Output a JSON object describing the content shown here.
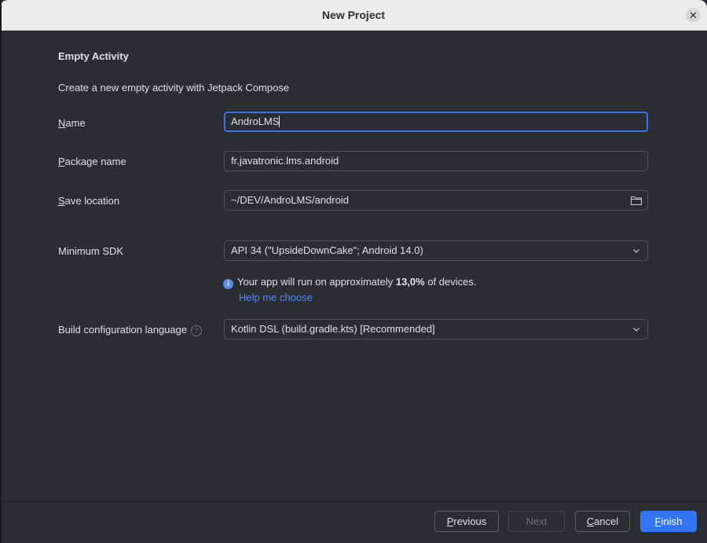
{
  "window": {
    "title": "New Project"
  },
  "header": {
    "section_title": "Empty Activity",
    "description": "Create a new empty activity with Jetpack Compose"
  },
  "form": {
    "name": {
      "label_mnemonic": "N",
      "label_rest": "ame",
      "value": "AndroLMS"
    },
    "package_name": {
      "label_mnemonic": "P",
      "label_rest": "ackage name",
      "value": "fr.javatronic.lms.android"
    },
    "save_location": {
      "label_mnemonic": "S",
      "label_rest": "ave location",
      "value": "~/DEV/AndroLMS/android"
    },
    "minimum_sdk": {
      "label": "Minimum SDK",
      "value": "API 34 (\"UpsideDownCake\"; Android 14.0)"
    },
    "sdk_info": {
      "prefix": "Your app will run on approximately ",
      "percent": "13,0%",
      "suffix": " of devices.",
      "help_link": "Help me choose"
    },
    "build_config_language": {
      "label": "Build configuration language",
      "value": "Kotlin DSL (build.gradle.kts) [Recommended]"
    }
  },
  "footer": {
    "previous": {
      "mnemonic": "P",
      "rest": "revious"
    },
    "next": {
      "label": "Next"
    },
    "cancel": {
      "mnemonic": "C",
      "rest": "ancel"
    },
    "finish": {
      "mnemonic": "F",
      "rest": "inish"
    }
  },
  "colors": {
    "accent": "#3574f0",
    "link": "#548af7",
    "background": "#2b2d30",
    "titlebar": "#ececec"
  },
  "icons": {
    "close": "close-icon",
    "folder": "folder-icon",
    "dropdown": "chevron-down-icon",
    "info": "info-icon",
    "help": "question-mark-icon"
  }
}
